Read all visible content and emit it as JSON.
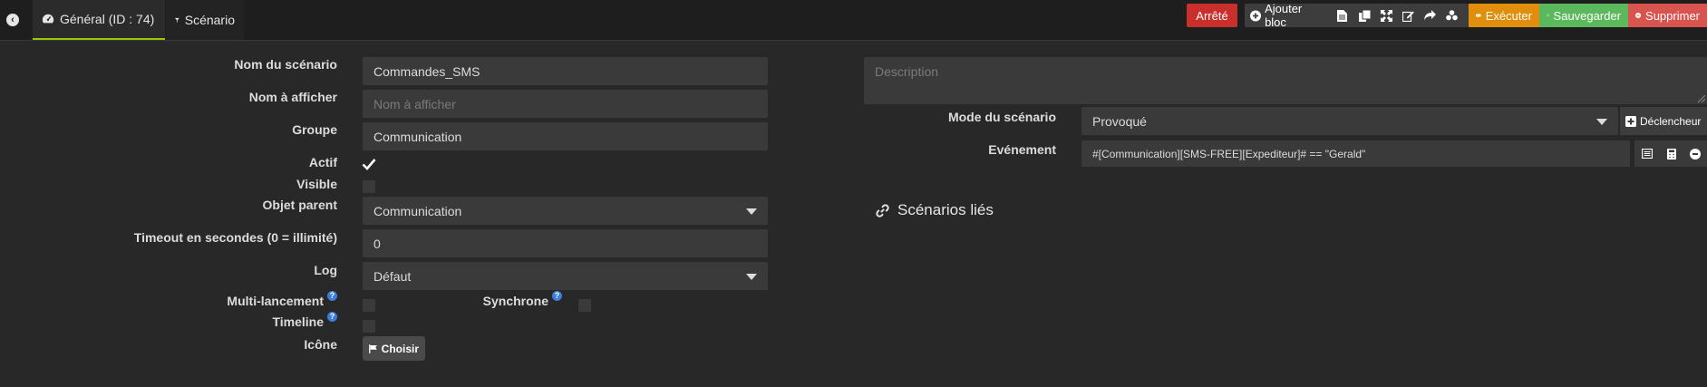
{
  "header": {
    "tabs": [
      {
        "label": "Général (ID : 74)",
        "icon": "dashboard-icon"
      },
      {
        "label": "Scénario",
        "icon": "filter-icon"
      }
    ],
    "state_label": "Arrêté",
    "actions": {
      "add_block": "Ajouter bloc",
      "execute": "Exécuter",
      "save": "Sauvegarder",
      "delete": "Supprimer"
    }
  },
  "form": {
    "name_label": "Nom du scénario",
    "name_value": "Commandes_SMS",
    "display_label": "Nom à afficher",
    "display_placeholder": "Nom à afficher",
    "group_label": "Groupe",
    "group_value": "Communication",
    "active_label": "Actif",
    "visible_label": "Visible",
    "parent_label": "Objet parent",
    "parent_value": "Communication",
    "timeout_label": "Timeout en secondes (0 = illimité)",
    "timeout_value": "0",
    "log_label": "Log",
    "log_value": "Défaut",
    "multi_label": "Multi-lancement",
    "sync_label": "Synchrone",
    "timeline_label": "Timeline",
    "icon_label": "Icône",
    "choose_label": "Choisir",
    "active_checked": true,
    "visible_checked": false
  },
  "right": {
    "description_placeholder": "Description",
    "mode_label": "Mode du scénario",
    "mode_value": "Provoqué",
    "trigger_button": "Déclencheur",
    "event_label": "Evénement",
    "event_value": "#[Communication][SMS-FREE][Expediteur]# == \"Gerald\"",
    "linked_title": "Scénarios liés"
  },
  "colors": {
    "background": "#282828",
    "field": "#3a3a3a",
    "state_red": "#c9302c",
    "execute_orange": "#e08e0b",
    "save_green": "#5cb85c",
    "delete_red": "#d9534f",
    "tab_active_border": "#94ca02"
  }
}
